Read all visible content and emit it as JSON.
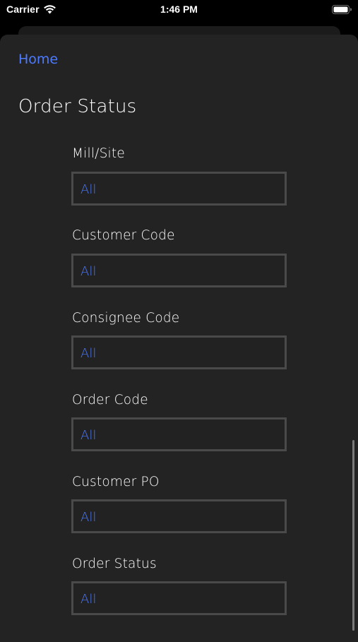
{
  "status_bar": {
    "carrier": "Carrier",
    "time": "1:46 PM"
  },
  "nav": {
    "home_label": "Home"
  },
  "page": {
    "title": "Order Status"
  },
  "fields": [
    {
      "label": "Mill/Site",
      "value": "All"
    },
    {
      "label": "Customer Code",
      "value": "All"
    },
    {
      "label": "Consignee Code",
      "value": "All"
    },
    {
      "label": "Order Code",
      "value": "All"
    },
    {
      "label": "Customer PO",
      "value": "All"
    },
    {
      "label": "Order Status",
      "value": "All"
    }
  ],
  "colors": {
    "accent": "#4d7bff",
    "sheet": "#232323",
    "field_border": "#4a4a4a"
  }
}
